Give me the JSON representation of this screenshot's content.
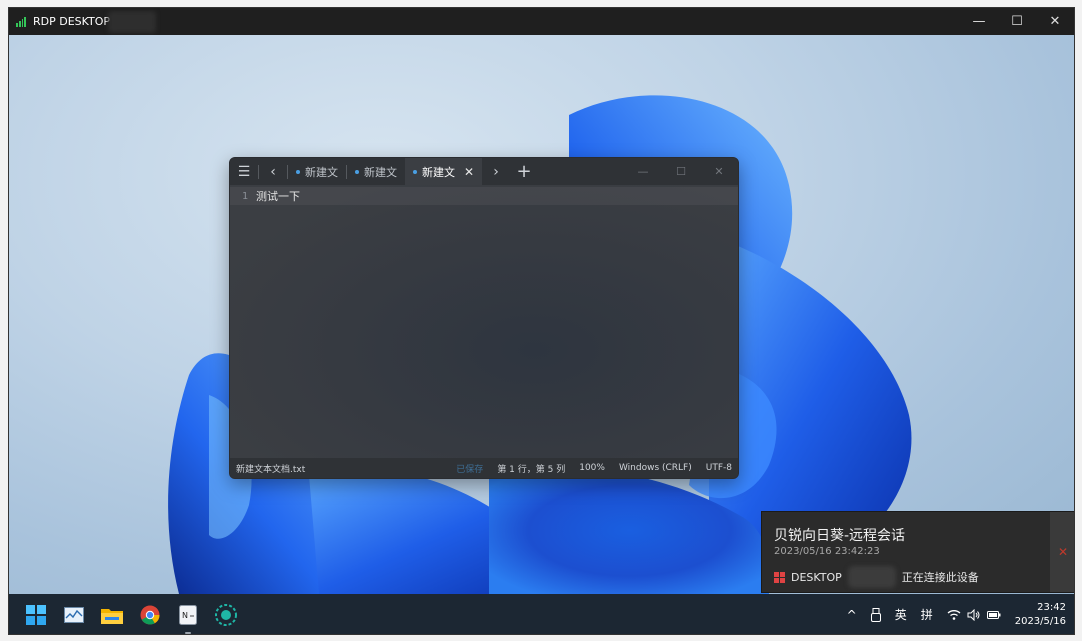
{
  "rdp": {
    "title": "RDP DESKTOP",
    "controls": {
      "minimize": "—",
      "maximize": "☐",
      "close": "✕"
    }
  },
  "notepad": {
    "tabs": [
      {
        "label": "新建文"
      },
      {
        "label": "新建文"
      },
      {
        "label": "新建文"
      }
    ],
    "line_number": "1",
    "line_text": "测试一下",
    "status": {
      "filename": "新建文本文档.txt",
      "highlight": "已保存",
      "position": "第 1 行，第 5 列",
      "zoom": "100%",
      "line_ending": "Windows (CRLF)",
      "encoding": "UTF-8"
    }
  },
  "notification": {
    "title": "贝锐向日葵-远程会话",
    "time": "2023/05/16 23:42:23",
    "device_prefix": "DESKTOP",
    "message": "正在连接此设备",
    "close": "✕"
  },
  "taskbar": {
    "tray": {
      "caret": "^",
      "lang1": "英",
      "lang2": "拼",
      "time": "23:42",
      "date": "2023/5/16"
    }
  },
  "colors": {
    "accent": "#4a9fe3",
    "taskbar": "#1c2733",
    "signal": "#34c759"
  }
}
